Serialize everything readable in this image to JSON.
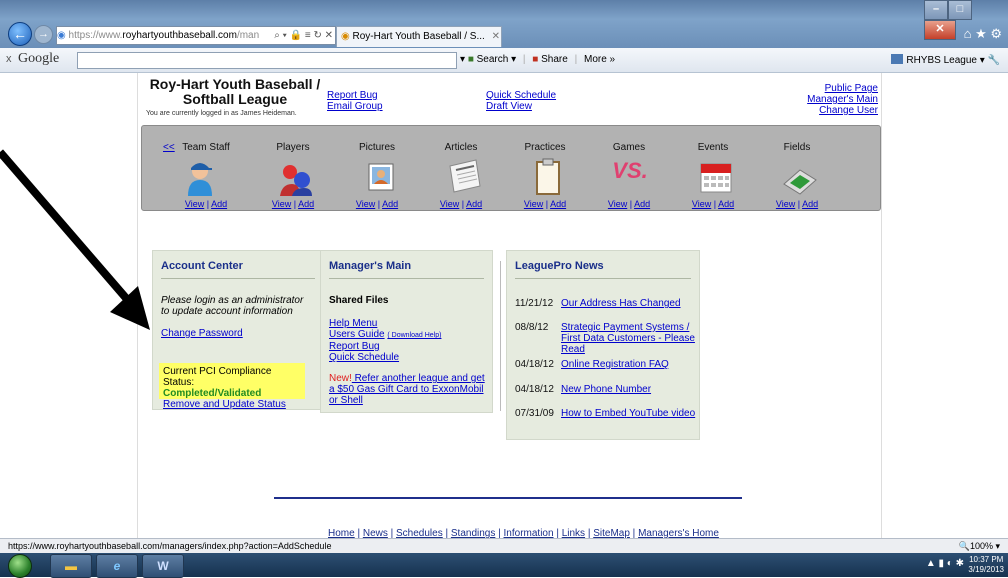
{
  "browser": {
    "address_prefix": "https://www.",
    "address_domain": "royhartyouthbaseball.com",
    "address_rest": "/man",
    "address_icons": "⌕ ▾ 🔒 ≡ ↻ ✕",
    "tab_title": "Roy-Hart Youth Baseball / S...",
    "tab_close": "✕",
    "nav_icons": "⌂ ★ ⚙"
  },
  "toolbar": {
    "close": "x",
    "brand": "Google",
    "search_label": "Search",
    "share_label": "Share",
    "more_label": "More »",
    "account_label": "RHYBS League ▾"
  },
  "header": {
    "title_line1": "Roy-Hart Youth Baseball /",
    "title_line2": "Softball League",
    "logged_in": "You are currently logged in as James Heideman.",
    "report_bug": "Report Bug",
    "email_group": "Email Group",
    "quick_schedule": "Quick Schedule",
    "draft_view": "Draft View",
    "public_page": "Public Page",
    "managers_main": "Manager's Main",
    "change_user": "Change User"
  },
  "nav": {
    "prev": "<<",
    "view": "View",
    "add": "Add",
    "pipe": " | ",
    "items": [
      {
        "label": "Team Staff"
      },
      {
        "label": "Players"
      },
      {
        "label": "Pictures"
      },
      {
        "label": "Articles"
      },
      {
        "label": "Practices"
      },
      {
        "label": "Games"
      },
      {
        "label": "Events"
      },
      {
        "label": "Fields"
      }
    ],
    "games_vs": "VS."
  },
  "account": {
    "heading": "Account Center",
    "message": "Please login as an administrator to update account information",
    "change_password": "Change Password",
    "pci_label": "Current PCI Compliance Status:",
    "pci_status": "Completed/Validated",
    "pci_link": "Remove and Update Status"
  },
  "manager": {
    "heading": "Manager's Main",
    "shared_files": "Shared Files",
    "help_menu": "Help Menu",
    "users_guide": "Users Guide",
    "download_help": "( Download Help)",
    "report_bug": "Report Bug",
    "quick_schedule": "Quick Schedule",
    "new_label": "New!",
    "promo": " Refer another league and get a $50 Gas Gift Card to ExxonMobil or Shell"
  },
  "news": {
    "heading": "LeaguePro News",
    "items": [
      {
        "date": "11/21/12",
        "title": "Our Address Has Changed"
      },
      {
        "date": "08/8/12",
        "title": "Strategic Payment Systems / First Data Customers - Please Read"
      },
      {
        "date": "04/18/12",
        "title": "Online Registration FAQ"
      },
      {
        "date": "04/18/12",
        "title": "New Phone Number"
      },
      {
        "date": "07/31/09",
        "title": "How to Embed YouTube video"
      }
    ]
  },
  "footer": {
    "links": [
      "Home",
      "News",
      "Schedules",
      "Standings",
      "Information",
      "Links",
      "SiteMap",
      "Managers's Home"
    ],
    "sep": " | "
  },
  "status": {
    "url": "https://www.royhartyouthbaseball.com/managers/index.php?action=AddSchedule",
    "zoom": "100% ▾"
  },
  "taskbar": {
    "clock_time": "10:37 PM",
    "clock_date": "3/19/2013",
    "word_label": "W"
  },
  "colors": {
    "link": "#0000cc",
    "panel_bg": "#e6ebdf",
    "pci_bg": "#ffff66",
    "pci_ok": "#228b22",
    "nav_strip": "#b2b2b2"
  }
}
